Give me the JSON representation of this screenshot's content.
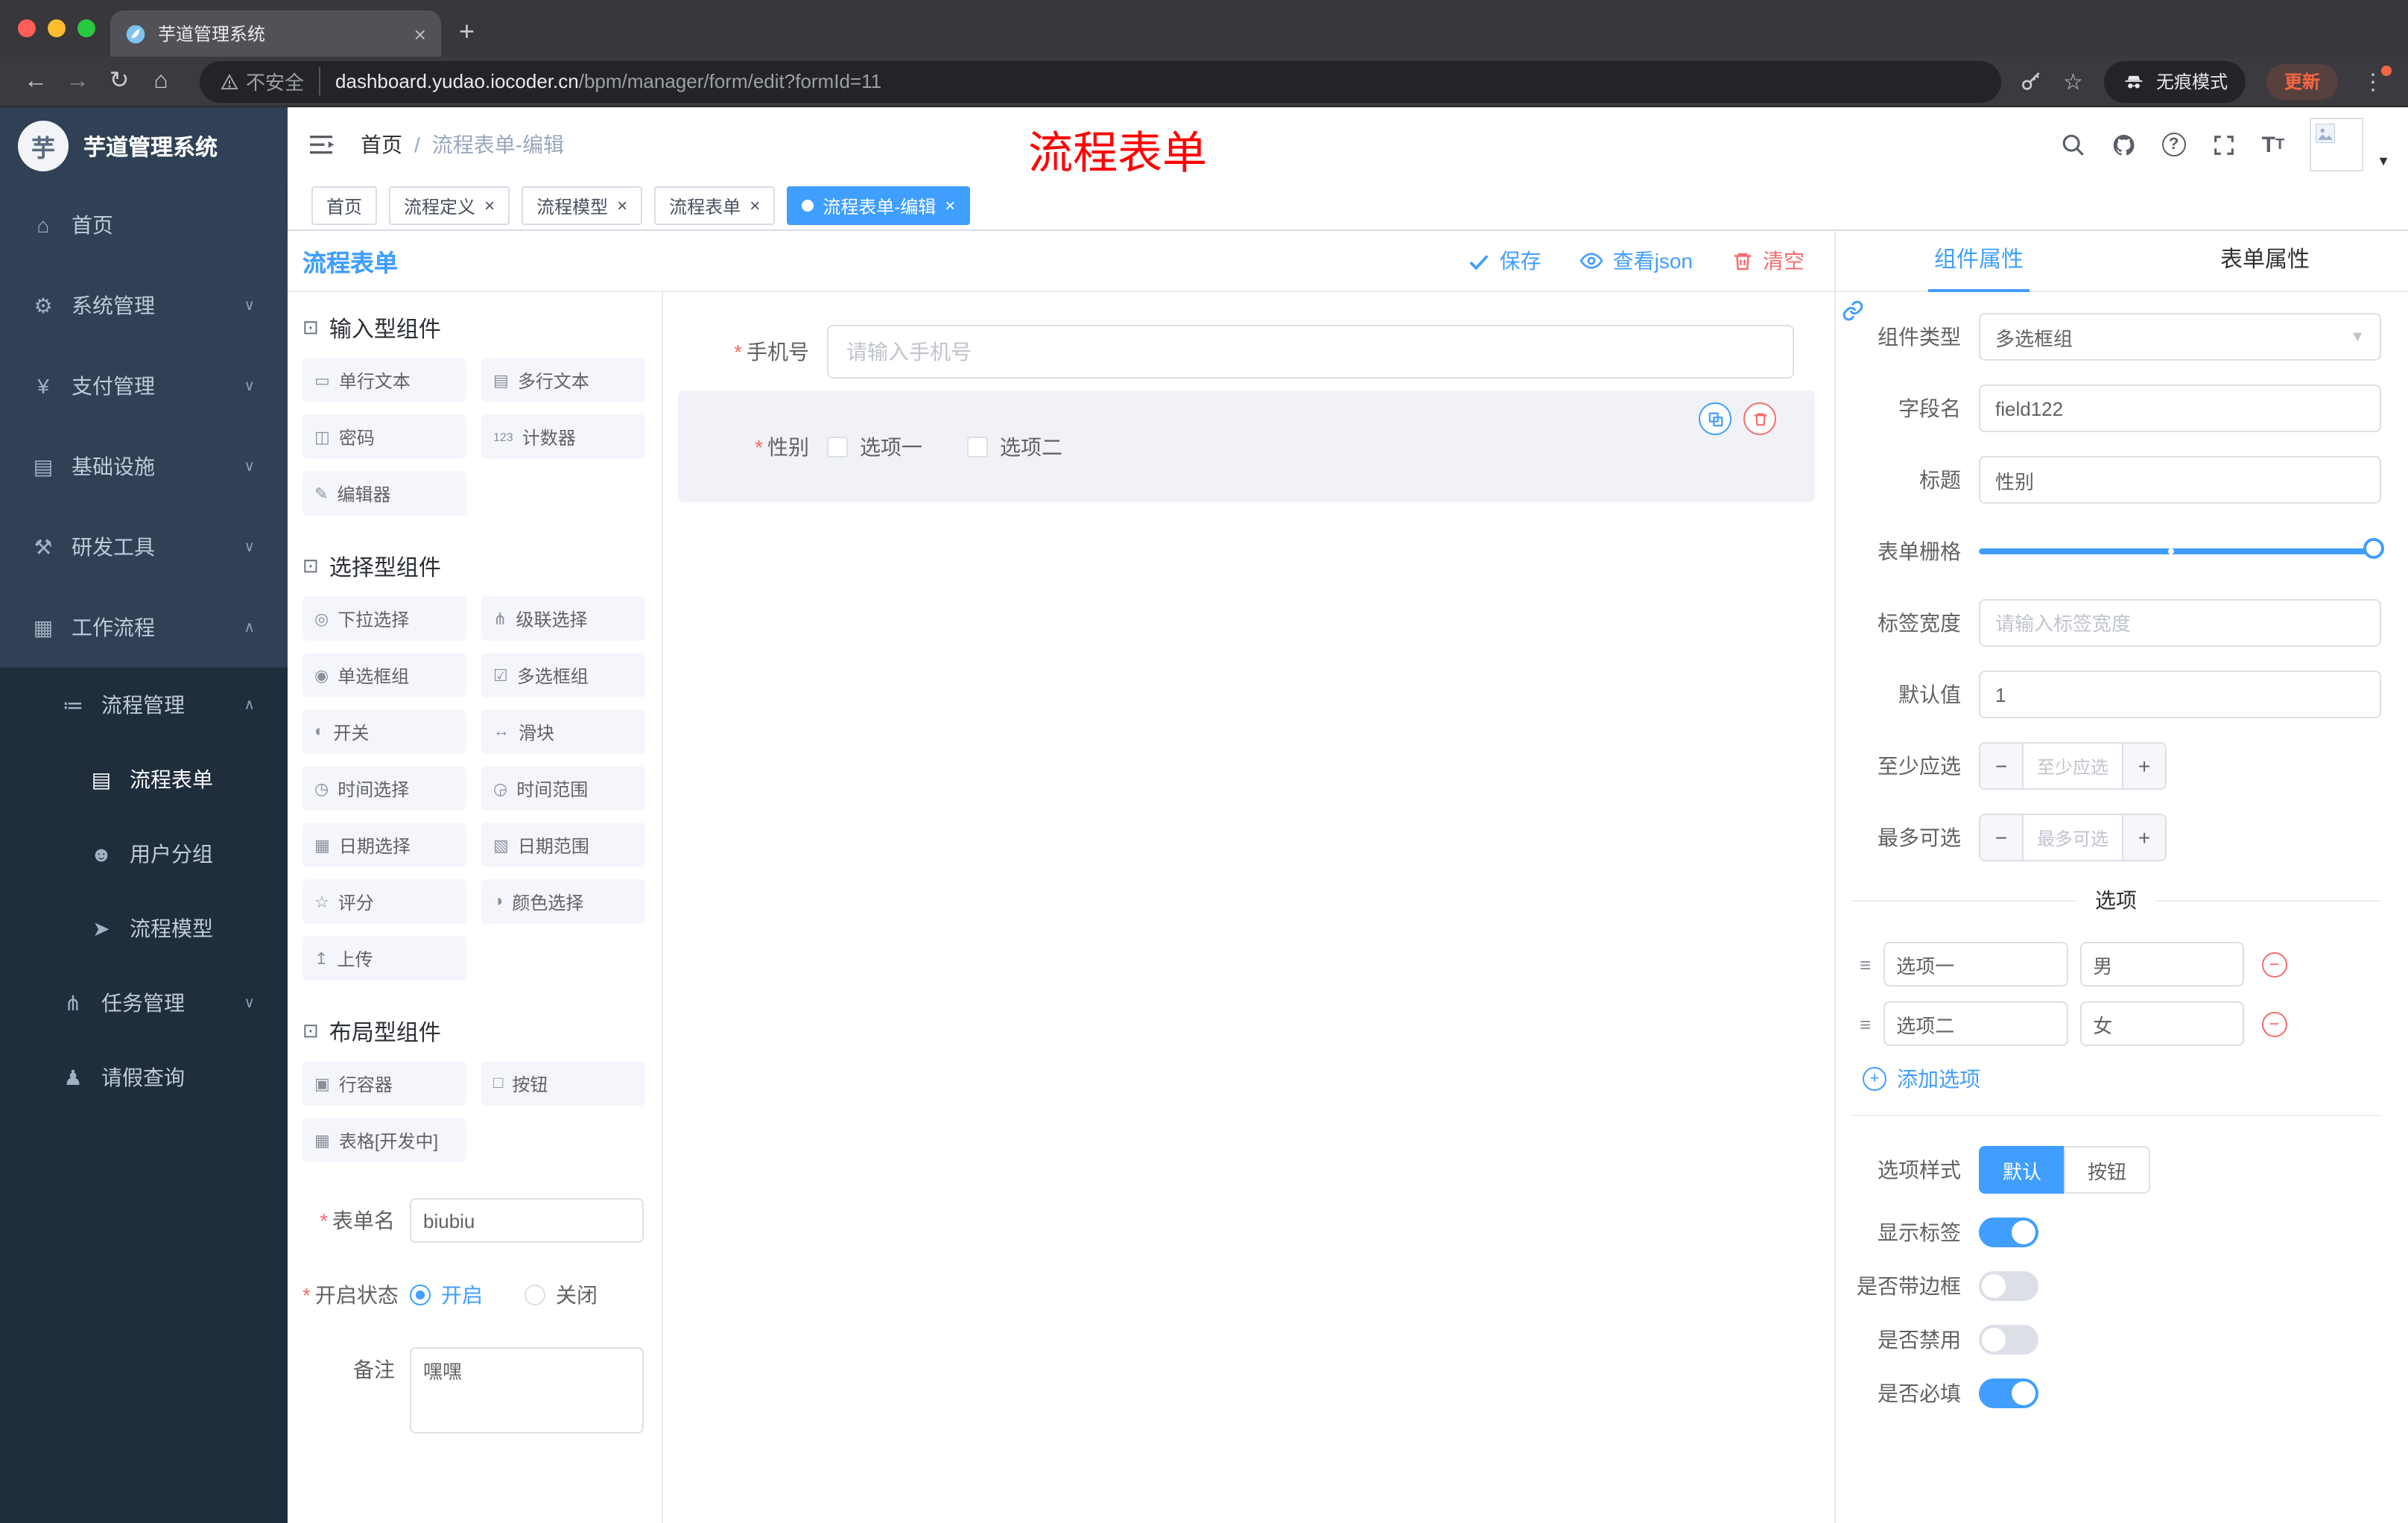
{
  "browser": {
    "tab_title": "芋道管理系统",
    "security_label": "不安全",
    "url_host": "dashboard.yudao.iocoder.cn",
    "url_path": "/bpm/manager/form/edit?formId=11",
    "incognito_label": "无痕模式",
    "update_label": "更新"
  },
  "sidebar": {
    "app_title": "芋道管理系统",
    "logo_char": "芋",
    "menu": [
      {
        "label": "首页",
        "icon": "home",
        "level": 0
      },
      {
        "label": "系统管理",
        "icon": "gear",
        "level": 0,
        "chevron": "down"
      },
      {
        "label": "支付管理",
        "icon": "yen",
        "level": 0,
        "chevron": "down"
      },
      {
        "label": "基础设施",
        "icon": "infra",
        "level": 0,
        "chevron": "down"
      },
      {
        "label": "研发工具",
        "icon": "tools",
        "level": 0,
        "chevron": "down"
      },
      {
        "label": "工作流程",
        "icon": "workflow",
        "level": 0,
        "chevron": "up"
      },
      {
        "label": "流程管理",
        "icon": "list",
        "level": 1,
        "chevron": "up",
        "dark": true
      },
      {
        "label": "流程表单",
        "icon": "form",
        "level": 2,
        "dark": true,
        "active": true
      },
      {
        "label": "用户分组",
        "icon": "users",
        "level": 2,
        "dark": true
      },
      {
        "label": "流程模型",
        "icon": "model",
        "level": 2,
        "dark": true
      },
      {
        "label": "任务管理",
        "icon": "tasks",
        "level": 1,
        "chevron": "down",
        "dark": true
      },
      {
        "label": "请假查询",
        "icon": "person",
        "level": 1,
        "dark": true
      }
    ]
  },
  "header": {
    "breadcrumb_home": "首页",
    "breadcrumb_sep": "/",
    "breadcrumb_current": "流程表单-编辑",
    "annotation": "流程表单"
  },
  "tags": [
    {
      "label": "首页",
      "closable": false
    },
    {
      "label": "流程定义",
      "closable": true
    },
    {
      "label": "流程模型",
      "closable": true
    },
    {
      "label": "流程表单",
      "closable": true
    },
    {
      "label": "流程表单-编辑",
      "closable": true,
      "active": true
    }
  ],
  "designer": {
    "title": "流程表单",
    "actions": {
      "save": "保存",
      "view_json": "查看json",
      "clear": "清空"
    },
    "palette": [
      {
        "title": "输入型组件",
        "items": [
          {
            "label": "单行文本",
            "icon": "input"
          },
          {
            "label": "多行文本",
            "icon": "textarea"
          },
          {
            "label": "密码",
            "icon": "password"
          },
          {
            "label": "计数器",
            "icon": "counter"
          },
          {
            "label": "编辑器",
            "icon": "editor"
          }
        ]
      },
      {
        "title": "选择型组件",
        "items": [
          {
            "label": "下拉选择",
            "icon": "select"
          },
          {
            "label": "级联选择",
            "icon": "cascade"
          },
          {
            "label": "单选框组",
            "icon": "radio"
          },
          {
            "label": "多选框组",
            "icon": "checkbox"
          },
          {
            "label": "开关",
            "icon": "switch"
          },
          {
            "label": "滑块",
            "icon": "slider"
          },
          {
            "label": "时间选择",
            "icon": "time"
          },
          {
            "label": "时间范围",
            "icon": "time-range"
          },
          {
            "label": "日期选择",
            "icon": "date"
          },
          {
            "label": "日期范围",
            "icon": "date-range"
          },
          {
            "label": "评分",
            "icon": "rate"
          },
          {
            "label": "颜色选择",
            "icon": "color"
          },
          {
            "label": "上传",
            "icon": "upload"
          }
        ]
      },
      {
        "title": "布局型组件",
        "items": [
          {
            "label": "行容器",
            "icon": "row"
          },
          {
            "label": "按钮",
            "icon": "button"
          },
          {
            "label": "表格[开发中]",
            "icon": "table"
          }
        ]
      }
    ],
    "meta": {
      "name_label": "表单名",
      "name_value": "biubiu",
      "status_label": "开启状态",
      "status_on": "开启",
      "status_off": "关闭",
      "remark_label": "备注",
      "remark_value": "嘿嘿"
    },
    "canvas": {
      "phone_label": "手机号",
      "phone_placeholder": "请输入手机号",
      "gender_label": "性别",
      "gender_options": [
        "选项一",
        "选项二"
      ]
    }
  },
  "props": {
    "tab_component": "组件属性",
    "tab_form": "表单属性",
    "component_type_label": "组件类型",
    "component_type_value": "多选框组",
    "field_name_label": "字段名",
    "field_name_value": "field122",
    "title_label": "标题",
    "title_value": "性别",
    "grid_label": "表单栅格",
    "label_width_label": "标签宽度",
    "label_width_placeholder": "请输入标签宽度",
    "default_label": "默认值",
    "default_value": "1",
    "min_label": "至少应选",
    "min_placeholder": "至少应选",
    "max_label": "最多可选",
    "max_placeholder": "最多可选",
    "options_title": "选项",
    "options": [
      {
        "label": "选项一",
        "value": "男"
      },
      {
        "label": "选项二",
        "value": "女"
      }
    ],
    "add_option": "添加选项",
    "style_label": "选项样式",
    "style_default": "默认",
    "style_button": "按钮",
    "show_label_label": "显示标签",
    "border_label": "是否带边框",
    "disabled_label": "是否禁用",
    "required_label": "是否必填",
    "switches": {
      "show_label": true,
      "border": false,
      "disabled": false,
      "required": true
    },
    "colors": {
      "primary": "#409eff",
      "danger": "#f56c6c"
    }
  }
}
